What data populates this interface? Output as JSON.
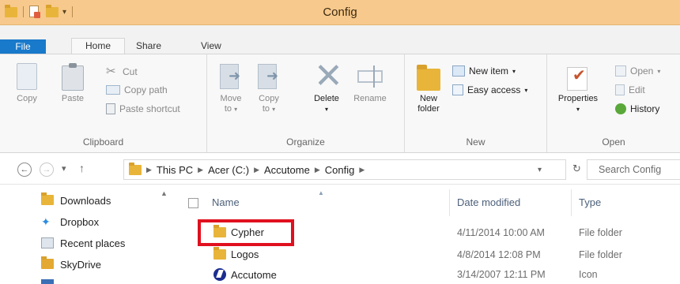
{
  "window": {
    "title": "Config"
  },
  "tabs": {
    "file": "File",
    "home": "Home",
    "share": "Share",
    "view": "View"
  },
  "ribbon": {
    "clipboard": {
      "label": "Clipboard",
      "copy": "Copy",
      "paste": "Paste",
      "cut": "Cut",
      "copy_path": "Copy path",
      "paste_shortcut": "Paste shortcut"
    },
    "organize": {
      "label": "Organize",
      "move_to_1": "Move",
      "move_to_2": "to",
      "copy_to_1": "Copy",
      "copy_to_2": "to",
      "delete": "Delete",
      "rename": "Rename"
    },
    "new": {
      "label": "New",
      "new_folder_1": "New",
      "new_folder_2": "folder",
      "new_item": "New item",
      "easy_access": "Easy access"
    },
    "open": {
      "label": "Open",
      "properties": "Properties",
      "open": "Open",
      "edit": "Edit",
      "history": "History"
    }
  },
  "address": {
    "crumbs": [
      "This PC",
      "Acer (C:)",
      "Accutome",
      "Config"
    ],
    "search_placeholder": "Search Config"
  },
  "nav_pane": {
    "items": [
      "Downloads",
      "Dropbox",
      "Recent places",
      "SkyDrive"
    ]
  },
  "file_list": {
    "columns": {
      "name": "Name",
      "date": "Date modified",
      "type": "Type"
    },
    "rows": [
      {
        "name": "Cypher",
        "date": "4/11/2014 10:00 AM",
        "type": "File folder",
        "icon": "folder-icon"
      },
      {
        "name": "Logos",
        "date": "4/8/2014 12:08 PM",
        "type": "File folder",
        "icon": "folder-icon"
      },
      {
        "name": "Accutome",
        "date": "3/14/2007 12:11 PM",
        "type": "Icon",
        "icon": "accutome-icon"
      }
    ]
  },
  "colors": {
    "titlebar": "#f7c98c",
    "file_tab": "#1979ca",
    "highlight": "#e0101f",
    "folder": "#e8b53a"
  }
}
